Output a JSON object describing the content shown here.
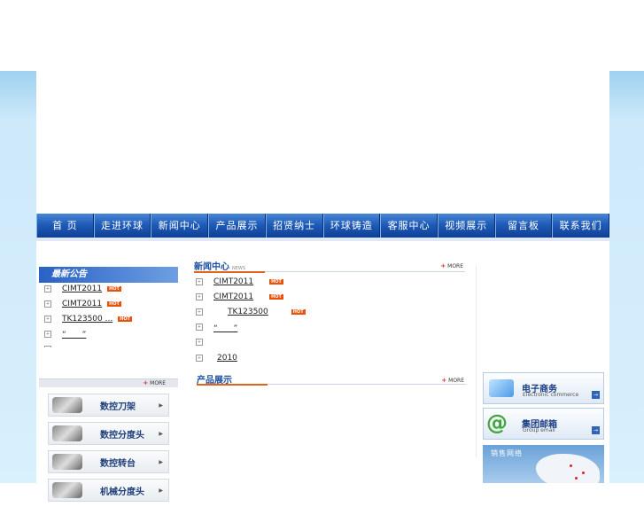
{
  "nav": {
    "items": [
      "首 页",
      "走进环球",
      "新闻中心",
      "产品展示",
      "招贤纳士",
      "环球铸造",
      "客服中心",
      "视频展示",
      "留言板",
      "联系我们"
    ]
  },
  "notice": {
    "title": "最新公告",
    "items": [
      {
        "text": "CIMT2011",
        "hot": "HOT"
      },
      {
        "text": "CIMT2011",
        "hot": "HOT"
      },
      {
        "text": "TK123500 ...",
        "hot": "HOT"
      },
      {
        "text": "“　　”",
        "hot": ""
      },
      {
        "text": "",
        "hot": ""
      }
    ]
  },
  "categories": {
    "more": "MORE",
    "items": [
      "数控刀架",
      "数控分度头",
      "数控转台",
      "机械分度头"
    ]
  },
  "news": {
    "title": "新闻中心",
    "subtitle": "NEWS",
    "more": "MORE",
    "items": [
      {
        "text": "CIMT2011",
        "hot": "HOT"
      },
      {
        "text": "CIMT2011",
        "hot": "HOT"
      },
      {
        "text": "TK123500",
        "hot": "HOT"
      },
      {
        "text": "“　　”",
        "hot": ""
      },
      {
        "text": "",
        "hot": ""
      },
      {
        "text": "2010",
        "hot": ""
      }
    ]
  },
  "products": {
    "title": "产品展示",
    "more": "MORE"
  },
  "ecommerce": {
    "title": "电子商务",
    "subtitle": "Electronic commerce"
  },
  "groupmail": {
    "title": "集团邮箱",
    "subtitle": "Group email"
  },
  "salesnet": {
    "title": "销售网络"
  },
  "colors": {
    "nav": "#1f5cb8",
    "accent": "#e0641c",
    "hot": "#e8520a"
  }
}
